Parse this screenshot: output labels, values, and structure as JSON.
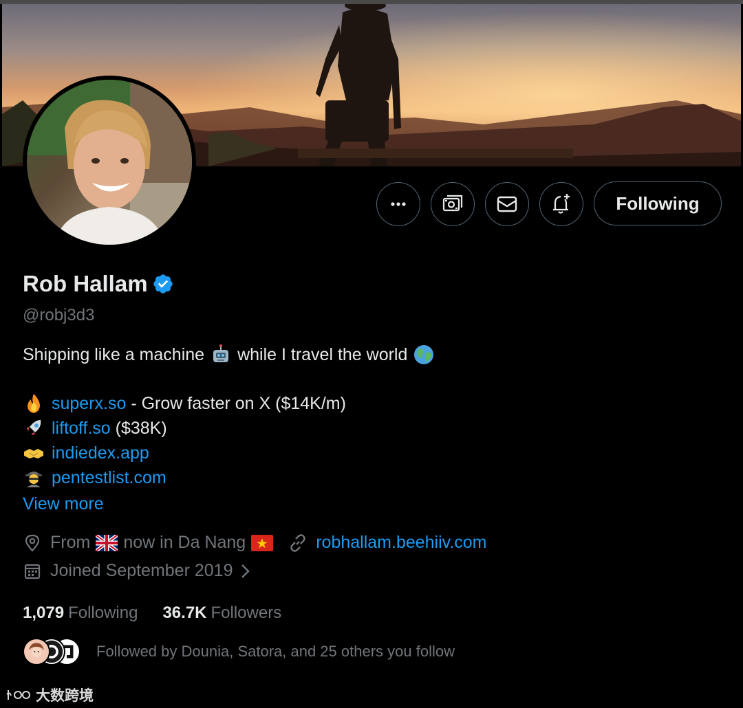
{
  "profile": {
    "name": "Rob Hallam",
    "handle": "@robj3d3",
    "follow_button_label": "Following"
  },
  "bio": {
    "line1_before": "Shipping like a machine",
    "line1_after": "while I travel the world",
    "links": [
      {
        "emoji": "fire",
        "link": "superx.so",
        "suffix": " - Grow faster on X ($14K/m)"
      },
      {
        "emoji": "rocket",
        "link": "liftoff.so",
        "suffix": " ($38K)"
      },
      {
        "emoji": "handshake",
        "link": "indiedex.app",
        "suffix": ""
      },
      {
        "emoji": "detective",
        "link": "pentestlist.com",
        "suffix": ""
      }
    ],
    "view_more": "View more"
  },
  "meta": {
    "location_from": "From",
    "location_now": "now in Da Nang",
    "website": "robhallam.beehiiv.com",
    "joined": "Joined September 2019"
  },
  "stats": {
    "following_count": "1,079",
    "following_label": "Following",
    "followers_count": "36.7K",
    "followers_label": "Followers"
  },
  "followed_by": "Followed by Dounia, Satora, and 25 others you follow",
  "watermark": "大数跨境",
  "icons": [
    "more-icon",
    "subscribe-icon",
    "mail-icon",
    "notification-bell-icon",
    "verified-badge-icon",
    "location-icon",
    "link-icon",
    "calendar-icon",
    "chevron-right-icon"
  ],
  "colors": {
    "link": "#1d9bf0",
    "muted": "#71767b",
    "text": "#e7e9ea",
    "verified": "#1d9bf0"
  }
}
